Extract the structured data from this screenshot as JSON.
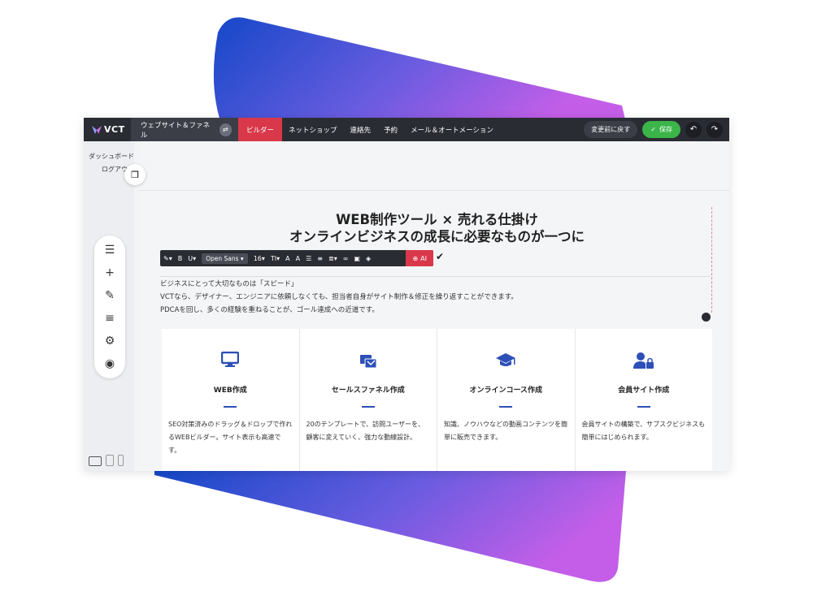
{
  "brand": {
    "logo": "VCT",
    "site_selector": "ウェブサイト＆ファネル"
  },
  "nav": [
    {
      "label": "ビルダー",
      "active": true
    },
    {
      "label": "ネットショップ",
      "active": false
    },
    {
      "label": "連絡先",
      "active": false
    },
    {
      "label": "予約",
      "active": false
    },
    {
      "label": "メール＆オートメーション",
      "active": false
    }
  ],
  "topbar_actions": {
    "revert": "変更前に戻す",
    "save": "保存"
  },
  "side_links": [
    "ダッシュボード",
    "ログアウト"
  ],
  "toolbox": [
    "menu-icon",
    "plus-icon",
    "brush-icon",
    "filter-icon",
    "gear-icon",
    "eye-icon"
  ],
  "hero": {
    "line1": "WEB制作ツール × 売れる仕掛け",
    "line2": "オンラインビジネスの成長に必要なものが一つに"
  },
  "format_bar": {
    "font": "Open Sans",
    "size": "16",
    "ai": "AI"
  },
  "body_text": [
    "ビジネスにとって大切なものは「スピード」",
    "VCTなら、デザイナー、エンジニアに依頼しなくても、担当者自身がサイト制作＆修正を繰り返すことができます。",
    "PDCAを回し、多くの経験を重ねることが、ゴール達成への近道です。"
  ],
  "cards": [
    {
      "icon": "monitor-icon",
      "title": "WEB作成",
      "text": "SEO対策済みのドラッグ＆ドロップで作れるWEBビルダー。サイト表示も高速です。"
    },
    {
      "icon": "funnel-icon",
      "title": "セールスファネル作成",
      "text": "20のテンプレートで、訪問ユーザーを、顧客に変えていく、強力な動線設計。"
    },
    {
      "icon": "graduation-cap-icon",
      "title": "オンラインコース作成",
      "text": "知識、ノウハウなどの動画コンテンツを簡単に販売できます。"
    },
    {
      "icon": "member-lock-icon",
      "title": "会員サイト作成",
      "text": "会員サイトの構築で、サブスクビジネスも簡単にはじめられます。"
    }
  ],
  "colors": {
    "accent": "#d9384a",
    "save": "#3bb54a",
    "icon_blue": "#2d4fb8",
    "topbar": "#2a2c33"
  }
}
